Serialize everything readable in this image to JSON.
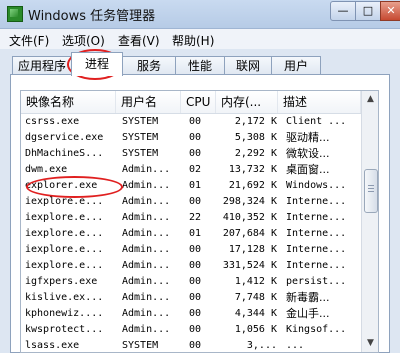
{
  "window": {
    "title": "Windows 任务管理器"
  },
  "menubar": {
    "items": [
      {
        "label": "文件(F)"
      },
      {
        "label": "选项(O)"
      },
      {
        "label": "查看(V)"
      },
      {
        "label": "帮助(H)"
      }
    ]
  },
  "tabs": [
    {
      "label": "应用程序"
    },
    {
      "label": "进程",
      "selected": true
    },
    {
      "label": "服务"
    },
    {
      "label": "性能"
    },
    {
      "label": "联网"
    },
    {
      "label": "用户"
    }
  ],
  "columns": [
    "映像名称",
    "用户名",
    "CPU",
    "内存(...",
    "描述"
  ],
  "rows": [
    {
      "name": "csrss.exe",
      "user": "SYSTEM",
      "cpu": "00",
      "mem": "2,172 K",
      "desc": "Client ..."
    },
    {
      "name": "dgservice.exe",
      "user": "SYSTEM",
      "cpu": "00",
      "mem": "5,308 K",
      "desc": "驱动精..."
    },
    {
      "name": "DhMachineS...",
      "user": "SYSTEM",
      "cpu": "00",
      "mem": "2,292 K",
      "desc": "微软设..."
    },
    {
      "name": "dwm.exe",
      "user": "Admin...",
      "cpu": "02",
      "mem": "13,732 K",
      "desc": "桌面窗..."
    },
    {
      "name": "explorer.exe",
      "user": "Admin...",
      "cpu": "01",
      "mem": "21,692 K",
      "desc": "Windows..."
    },
    {
      "name": "iexplore.e...",
      "user": "Admin...",
      "cpu": "00",
      "mem": "298,324 K",
      "desc": "Interne..."
    },
    {
      "name": "iexplore.e...",
      "user": "Admin...",
      "cpu": "22",
      "mem": "410,352 K",
      "desc": "Interne..."
    },
    {
      "name": "iexplore.e...",
      "user": "Admin...",
      "cpu": "01",
      "mem": "207,684 K",
      "desc": "Interne..."
    },
    {
      "name": "iexplore.e...",
      "user": "Admin...",
      "cpu": "00",
      "mem": "17,128 K",
      "desc": "Interne..."
    },
    {
      "name": "iexplore.e...",
      "user": "Admin...",
      "cpu": "00",
      "mem": "331,524 K",
      "desc": "Interne..."
    },
    {
      "name": "igfxpers.exe",
      "user": "Admin...",
      "cpu": "00",
      "mem": "1,412 K",
      "desc": "persist..."
    },
    {
      "name": "kislive.ex...",
      "user": "Admin...",
      "cpu": "00",
      "mem": "7,748 K",
      "desc": "新毒霸..."
    },
    {
      "name": "kphonewiz....",
      "user": "Admin...",
      "cpu": "00",
      "mem": "4,344 K",
      "desc": "金山手..."
    },
    {
      "name": "kwsprotect...",
      "user": "Admin...",
      "cpu": "00",
      "mem": "1,056 K",
      "desc": "Kingsof..."
    },
    {
      "name": "lsass.exe",
      "user": "SYSTEM",
      "cpu": "00",
      "mem": "3,...",
      "desc": "..."
    }
  ],
  "accent_colors": {
    "annotation": "#e02020"
  }
}
